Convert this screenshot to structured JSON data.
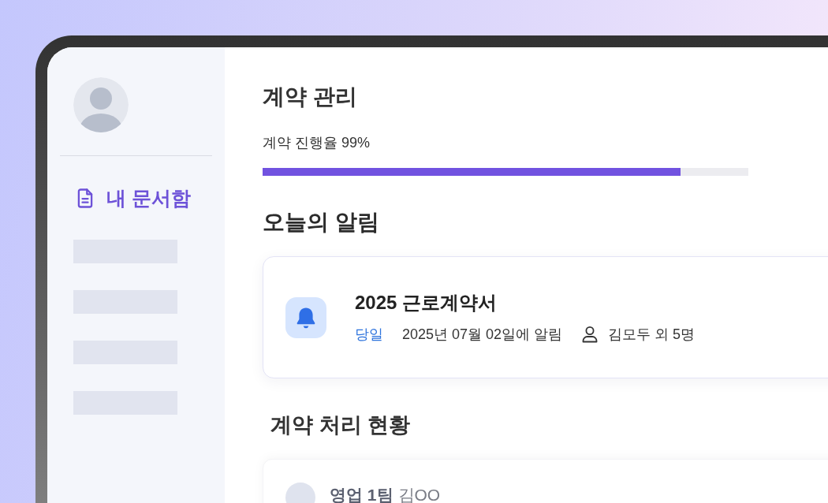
{
  "sidebar": {
    "items": [
      {
        "kind": "link",
        "label": "내 문서함",
        "selected": true
      },
      {
        "kind": "skeleton"
      },
      {
        "kind": "skeleton"
      },
      {
        "kind": "skeleton"
      },
      {
        "kind": "skeleton"
      }
    ]
  },
  "contract": {
    "title": "계약 관리",
    "progress": {
      "label": "계약 진행율 99%",
      "level": 0.86
    }
  },
  "notifications": {
    "heading": "오늘의 알림",
    "items": [
      {
        "title": "2025 근로계약서",
        "badge": "당일",
        "date": "2025년 07월 02일에 알림",
        "recipients": "김모두 외 5명"
      }
    ]
  },
  "status": {
    "heading": "계약 처리 현황",
    "rows": [
      {
        "team": "영업 1팀",
        "person": "김OO"
      }
    ]
  }
}
